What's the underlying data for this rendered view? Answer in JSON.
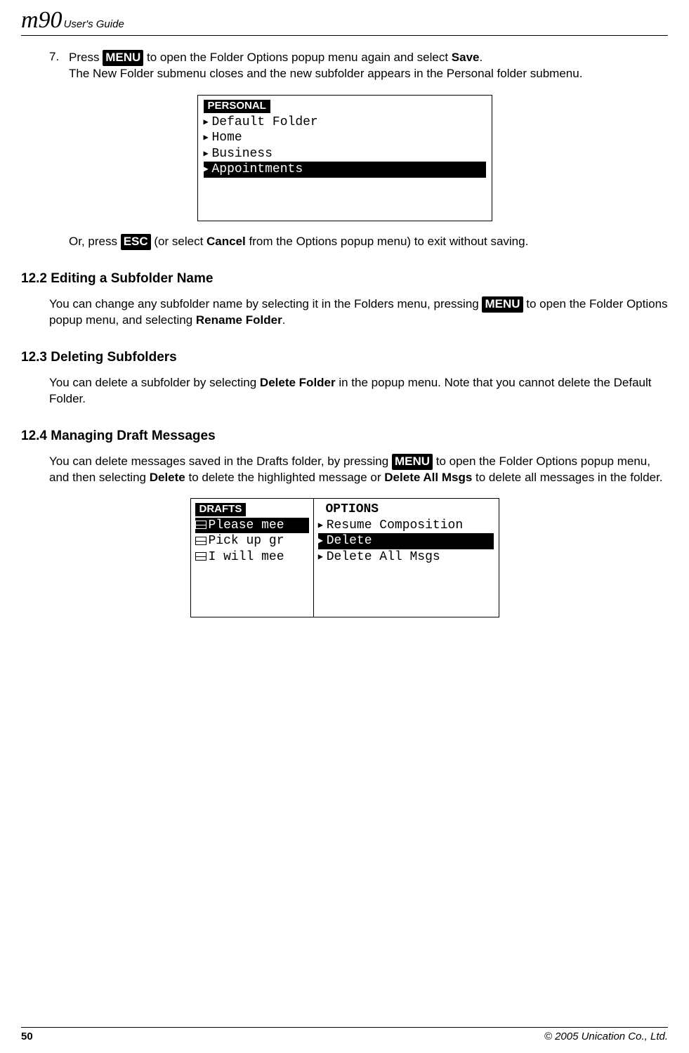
{
  "header": {
    "logo": "m90",
    "title": "User's Guide"
  },
  "step7": {
    "num": "7.",
    "pre": "Press ",
    "key": "MENU",
    "post": " to open the Folder Options popup menu again and select ",
    "bold1": "Save",
    "tail": ".",
    "line2": "The New Folder submenu closes and the new subfolder appears in the Personal folder submenu."
  },
  "screen1": {
    "title": "PERSONAL",
    "lines": [
      "Default Folder",
      "Home",
      "Business",
      "Appointments"
    ],
    "selected": "Appointments"
  },
  "orpara": {
    "pre": "Or, press ",
    "key": "ESC",
    "mid": " (or select ",
    "bold": "Cancel",
    "post": " from the Options popup menu) to exit without saving."
  },
  "s122": {
    "heading": "12.2  Editing a Subfolder Name",
    "p_pre": "You can change any subfolder name by selecting it in the Folders menu, pressing ",
    "p_key": "MENU",
    "p_mid": " to open the Folder Options popup menu, and selecting ",
    "p_bold": "Rename Folder",
    "p_post": "."
  },
  "s123": {
    "heading": "12.3  Deleting Subfolders",
    "p_pre": "You can delete a subfolder by selecting ",
    "p_bold": "Delete Folder",
    "p_post": " in the popup menu. Note that you cannot delete the Default Folder."
  },
  "s124": {
    "heading": "12.4  Managing Draft Messages",
    "p_pre": "You can delete messages saved in the Drafts folder, by pressing ",
    "p_key": "MENU",
    "p_mid": " to open the Folder Options popup menu, and then selecting ",
    "p_b1": "Delete",
    "p_mid2": " to delete the highlighted message or ",
    "p_b2": "Delete All Msgs",
    "p_post": " to delete all messages in the folder."
  },
  "screen2": {
    "leftTitle": "DRAFTS",
    "leftLines": [
      "Please mee",
      "Pick up gr",
      "I will mee"
    ],
    "leftSelected": "Please mee",
    "rightTitle": "OPTIONS",
    "rightLines": [
      "Resume Composition",
      "Delete",
      "Delete All Msgs"
    ],
    "rightSelected": "Delete"
  },
  "footer": {
    "page": "50",
    "copyright": "© 2005 Unication Co., Ltd."
  }
}
